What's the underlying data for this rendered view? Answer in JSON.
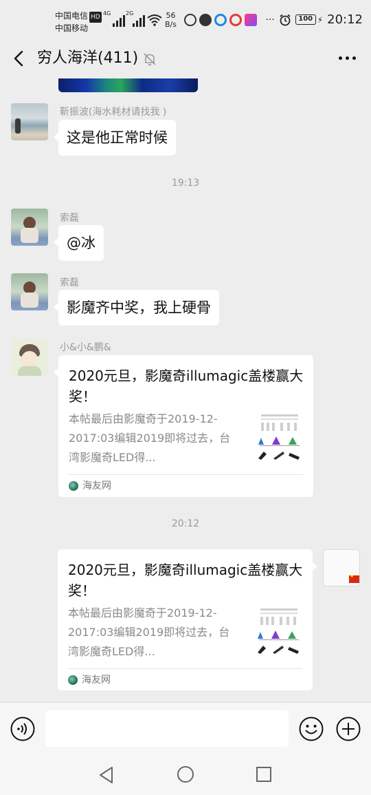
{
  "status_bar": {
    "carrier1": "中国电信",
    "carrier1_badge": "HD",
    "carrier2": "中国移动",
    "sig1_label": "4G",
    "sig2_label": "2G",
    "net_speed_value": "56",
    "net_speed_unit": "B/s",
    "more": "···",
    "battery": "100",
    "time": "20:12"
  },
  "header": {
    "title": "穷人海洋(411)"
  },
  "messages": [
    {
      "sender": "靳振波(海水耗材请找我 )",
      "text": "这是他正常时候"
    },
    {
      "timestamp": "19:13"
    },
    {
      "sender": "索磊",
      "text": "@冰"
    },
    {
      "sender": "索磊",
      "text": "影魔齐中奖，我上硬骨"
    },
    {
      "sender": "小&小&鹏&",
      "card": {
        "title": "2020元旦，影魔奇illumagic盖楼赢大奖！",
        "description": "本帖最后由影魔奇于2019-12-2017:03编辑2019即将过去，台湾影魔奇LED得...",
        "source": "海友网"
      }
    },
    {
      "timestamp": "20:12"
    },
    {
      "self": true,
      "card": {
        "title": "2020元旦，影魔奇illumagic盖楼赢大奖！",
        "description": "本帖最后由影魔奇于2019-12-2017:03编辑2019即将过去，台湾影魔奇LED得...",
        "source": "海友网"
      }
    }
  ],
  "input": {
    "value": ""
  },
  "colors": {
    "background": "#ededed",
    "bubble": "#ffffff",
    "meta_text": "#9a9a9a"
  }
}
